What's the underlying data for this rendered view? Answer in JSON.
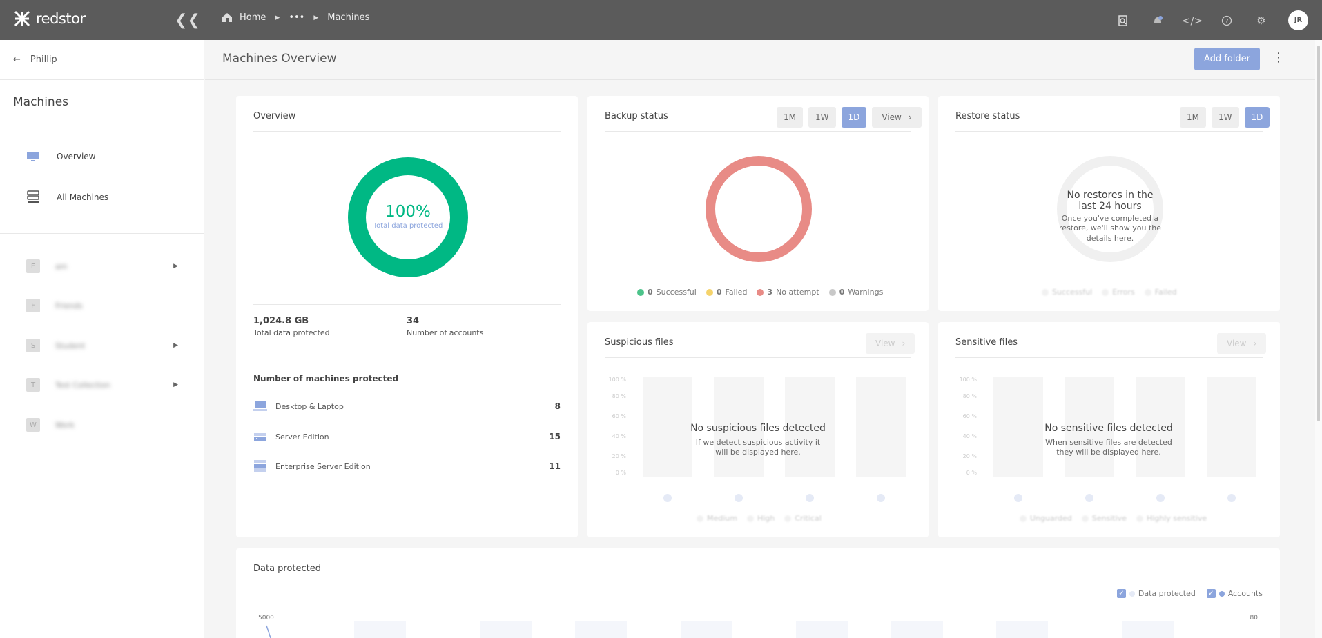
{
  "app": {
    "brand": "redstor",
    "user_initials": "JR"
  },
  "breadcrumb": {
    "home": "Home",
    "ellipsis": "•••",
    "current": "Machines"
  },
  "sidebar": {
    "back_label": "Phillip",
    "section_title": "Machines",
    "nav": [
      {
        "label": "Overview",
        "icon": "monitor-icon"
      },
      {
        "label": "All Machines",
        "icon": "server-stack-icon"
      }
    ],
    "groups": [
      {
        "letter": "E",
        "name": "am",
        "expandable": true
      },
      {
        "letter": "F",
        "name": "Friends",
        "expandable": false
      },
      {
        "letter": "S",
        "name": "Student",
        "expandable": true
      },
      {
        "letter": "T",
        "name": "Test Collection",
        "expandable": true
      },
      {
        "letter": "W",
        "name": "Work",
        "expandable": false
      }
    ]
  },
  "header": {
    "title": "Machines Overview",
    "add_folder": "Add folder"
  },
  "overview": {
    "title": "Overview",
    "percent": "100%",
    "percent_label": "Total data protected",
    "total_value": "1,024.8 GB",
    "total_label": "Total data protected",
    "accounts_value": "34",
    "accounts_label": "Number of accounts",
    "machines_title": "Number of machines protected",
    "machines": [
      {
        "label": "Desktop & Laptop",
        "count": "8",
        "icon": "laptop-icon"
      },
      {
        "label": "Server Edition",
        "count": "15",
        "icon": "server-icon"
      },
      {
        "label": "Enterprise Server Edition",
        "count": "11",
        "icon": "enterprise-server-icon"
      }
    ],
    "donut_fraction": 1.0
  },
  "backup": {
    "title": "Backup status",
    "periods": [
      "1M",
      "1W",
      "1D"
    ],
    "active": "1D",
    "view": "View",
    "legend": [
      {
        "count": "0",
        "label": "Successful",
        "color": "#4cc38a"
      },
      {
        "count": "0",
        "label": "Failed",
        "color": "#f5d36b"
      },
      {
        "count": "3",
        "label": "No attempt",
        "color": "#e88b86"
      },
      {
        "count": "0",
        "label": "Warnings",
        "color": "#c8c8c8"
      }
    ]
  },
  "restore": {
    "title": "Restore status",
    "periods": [
      "1M",
      "1W",
      "1D"
    ],
    "active": "1D",
    "empty_title": "No restores in the last 24 hours",
    "empty_text": "Once you've completed a restore, we'll show you the details here.",
    "legend": [
      "Successful",
      "Errors",
      "Failed"
    ]
  },
  "suspicious": {
    "title": "Suspicious files",
    "view": "View",
    "empty_title": "No suspicious files detected",
    "empty_text": "If we detect suspicious activity it will be displayed here.",
    "ticks": [
      "100 %",
      "80 %",
      "60 %",
      "40 %",
      "20 %",
      "0 %"
    ],
    "legend": [
      "Medium",
      "High",
      "Critical"
    ]
  },
  "sensitive": {
    "title": "Sensitive files",
    "view": "View",
    "empty_title": "No sensitive files detected",
    "empty_text": "When sensitive files are detected they will be displayed here.",
    "ticks": [
      "100 %",
      "80 %",
      "60 %",
      "40 %",
      "20 %",
      "0 %"
    ],
    "legend": [
      "Unguarded",
      "Sensitive",
      "Highly sensitive"
    ]
  },
  "data_protected": {
    "title": "Data protected",
    "legend": [
      {
        "label": "Data protected",
        "checked": true
      },
      {
        "label": "Accounts",
        "checked": true
      }
    ],
    "y_left_top": "5000",
    "y_right_top": "80"
  },
  "colors": {
    "accent": "#8ca5dd",
    "green": "#00b884",
    "red": "#e88b86"
  }
}
